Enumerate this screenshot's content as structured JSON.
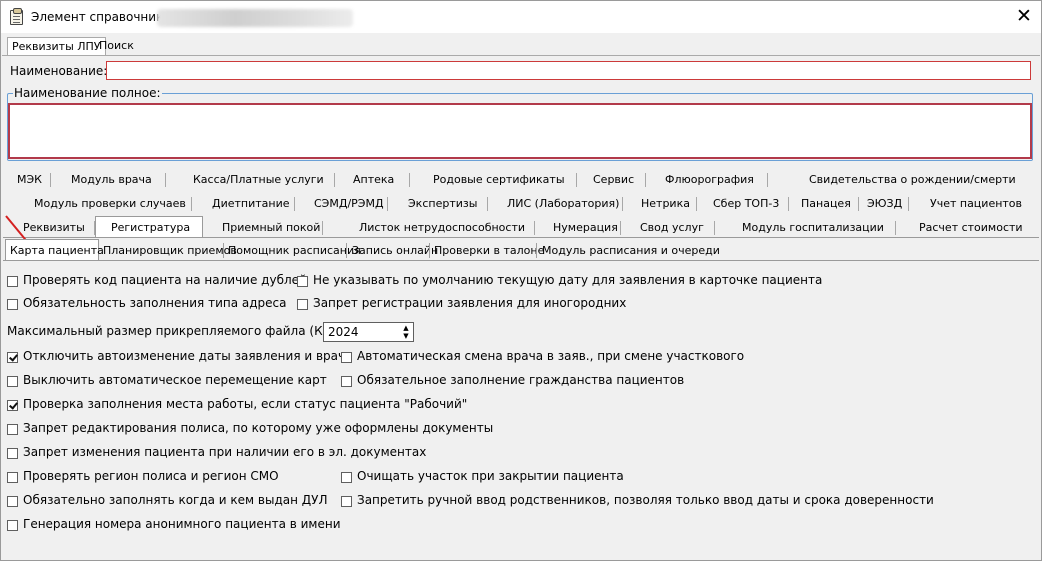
{
  "window": {
    "title": "Элемент справочника:",
    "close_glyph": "✕"
  },
  "top_tabs": [
    {
      "label": "Реквизиты ЛПУ",
      "selected": true
    },
    {
      "label": "Поиск",
      "selected": false
    }
  ],
  "fields": {
    "name_label": "Наименование:",
    "name_value": "",
    "fullname_label": "Наименование полное:",
    "fullname_value": ""
  },
  "tab_row1": [
    "МЭК",
    "Модуль врача",
    "Касса/Платные услуги",
    "Аптека",
    "Родовые сертификаты",
    "Сервис",
    "Флюорография",
    "Свидетельства о рождении/смерти"
  ],
  "tab_row2": [
    "Модуль проверки случаев",
    "Диетпитание",
    "СЭМД/РЭМД",
    "Экспертизы",
    "ЛИС (Лаборатория)",
    "Нетрика",
    "Сбер ТОП-3",
    "Панацея",
    "ЭЮЗД",
    "Учет пациентов"
  ],
  "tab_row3": [
    "Реквизиты",
    "Регистратура",
    "Приемный покой",
    "Листок нетрудоспособности",
    "Нумерация",
    "Свод услуг",
    "Модуль госпитализации",
    "Расчет стоимости"
  ],
  "tab_row3_selected": "Регистратура",
  "sub_tabs": [
    "Карта пациента",
    "Планировщик приемов",
    "Помощник расписания",
    "Запись онлайн",
    "Проверки в талоне",
    "Модуль расписания и очереди"
  ],
  "sub_tab_selected": "Карта пациента",
  "options": {
    "c1": {
      "label": "Проверять код пациента на наличие дублей",
      "checked": false
    },
    "c2": {
      "label": "Не указывать по умолчанию текущую дату для заявления в карточке пациента",
      "checked": false
    },
    "c3": {
      "label": "Обязательность заполнения типа адреса",
      "checked": false
    },
    "c4": {
      "label": "Запрет регистрации заявления для иногородних",
      "checked": false
    },
    "max_file_label": "Максимальный размер прикрепляемого файла (Кб):",
    "max_file_value": "2024",
    "c5": {
      "label": "Отключить автоизменение даты заявления и врача",
      "checked": true
    },
    "c6": {
      "label": "Автоматическая смена врача в заяв., при смене участкового",
      "checked": false
    },
    "c7": {
      "label": "Выключить автоматическое перемещение карт",
      "checked": false
    },
    "c8": {
      "label": "Обязательное заполнение гражданства пациентов",
      "checked": false
    },
    "c9": {
      "label": "Проверка заполнения места работы, если статус пациента \"Рабочий\"",
      "checked": true
    },
    "c10": {
      "label": "Запрет редактирования полиса, по которому уже оформлены документы",
      "checked": false
    },
    "c11": {
      "label": "Запрет изменения пациента при наличии его в эл. документах",
      "checked": false
    },
    "c12": {
      "label": "Проверять регион полиса и регион СМО",
      "checked": false
    },
    "c13": {
      "label": "Очищать участок при закрытии пациента",
      "checked": false
    },
    "c14": {
      "label": "Обязательно заполнять когда и кем выдан ДУЛ",
      "checked": false
    },
    "c15": {
      "label": "Запретить ручной ввод родственников, позволяя только ввод даты и срока доверенности",
      "checked": false
    },
    "c16": {
      "label": "Генерация номера анонимного пациента в имени",
      "checked": false
    }
  },
  "colors": {
    "accent_red": "#cc3a3a",
    "group_border": "#6aa0d6",
    "arrow": "#d42020"
  }
}
